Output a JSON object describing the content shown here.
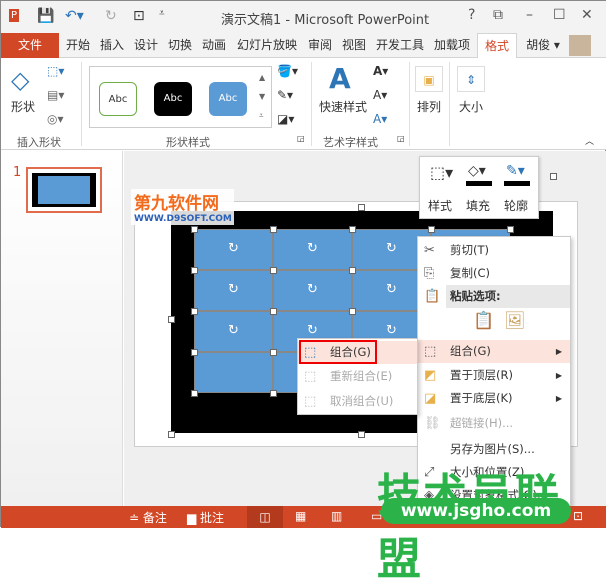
{
  "app": {
    "title": "演示文稿1 - Microsoft PowerPoint",
    "help": "?",
    "ribbon_display": "⧉",
    "minimize": "–",
    "maximize": "☐",
    "close": "✕"
  },
  "quick_access": {
    "save_icon": "save-icon",
    "undo_icon": "undo-icon",
    "redo_icon": "redo-icon",
    "present_icon": "slideshow-icon"
  },
  "tabs": [
    {
      "label": "文件"
    },
    {
      "label": "开始"
    },
    {
      "label": "插入"
    },
    {
      "label": "设计"
    },
    {
      "label": "切换"
    },
    {
      "label": "动画"
    },
    {
      "label": "幻灯片放映"
    },
    {
      "label": "审阅"
    },
    {
      "label": "视图"
    },
    {
      "label": "开发工具"
    },
    {
      "label": "加载项"
    },
    {
      "label": "格式"
    }
  ],
  "active_tab": "格式",
  "user": {
    "name": "胡俊"
  },
  "ribbon": {
    "insert_shapes": {
      "shapes_label": "形状",
      "group": "插入形状"
    },
    "shape_styles": {
      "samples": [
        "Abc",
        "Abc",
        "Abc"
      ],
      "group": "形状样式"
    },
    "wordart": {
      "quick_styles": "快速样式",
      "group": "艺术字样式"
    },
    "arrange": {
      "label": "排列"
    },
    "size": {
      "label": "大小"
    }
  },
  "thumbnail": {
    "number": "1"
  },
  "logo_watermark": {
    "name": "第九软件网",
    "url": "WWW.D9SOFT.COM"
  },
  "mini_toolbar": {
    "style": "样式",
    "fill": "填充",
    "outline": "轮廓"
  },
  "context_menu": [
    {
      "label": "剪切(T)",
      "icon": "scissors-icon"
    },
    {
      "label": "复制(C)",
      "icon": "copy-icon"
    },
    {
      "label": "粘贴选项:",
      "icon": "paste-icon"
    },
    {
      "label": "组合(G)",
      "icon": "group-icon"
    },
    {
      "label": "置于顶层(R)",
      "icon": "bring-front-icon"
    },
    {
      "label": "置于底层(K)",
      "icon": "send-back-icon"
    },
    {
      "label": "超链接(H)...",
      "icon": "link-icon"
    },
    {
      "label": "另存为图片(S)..."
    },
    {
      "label": "大小和位置(Z)..."
    },
    {
      "label": "设置对象格式(O)..."
    }
  ],
  "submenu": [
    {
      "label": "组合(G)"
    },
    {
      "label": "重新组合(E)"
    },
    {
      "label": "取消组合(U)"
    }
  ],
  "status": {
    "notes": "备注",
    "comments": "批注"
  },
  "watermark": {
    "text": "技术员联盟",
    "url": "www.jsgho.com"
  },
  "colors": {
    "accent": "#d24726",
    "shape_fill": "#5b9bd5",
    "highlight": "#fce4dc"
  }
}
